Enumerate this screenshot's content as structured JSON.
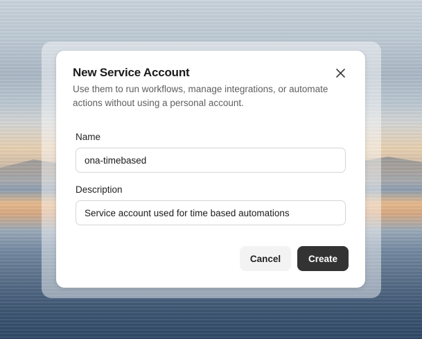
{
  "dialog": {
    "title": "New Service Account",
    "description": "Use them to run workflows, manage integrations, or automate actions without using a personal account.",
    "close_icon": "close-icon"
  },
  "form": {
    "name_label": "Name",
    "name_value": "ona-timebased",
    "description_label": "Description",
    "description_value": "Service account used for time based automations"
  },
  "actions": {
    "cancel_label": "Cancel",
    "create_label": "Create"
  },
  "colors": {
    "primary_button": "#333333",
    "secondary_button": "#f3f3f3"
  }
}
